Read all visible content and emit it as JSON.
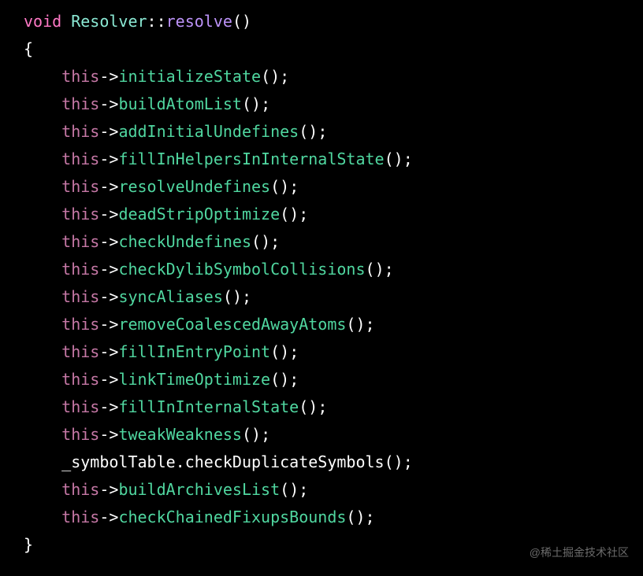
{
  "code": {
    "keyword_void": "void",
    "class_name": "Resolver",
    "scope_op": "::",
    "function_name": "resolve",
    "paren_open": "(",
    "paren_close": ")",
    "brace_open": "{",
    "brace_close": "}",
    "indent": "    ",
    "this_kw": "this",
    "arrow": "->",
    "semicolon": ";",
    "member_obj": "_symbolTable",
    "dot": ".",
    "member_call": "checkDuplicateSymbols",
    "methods": {
      "m0": "initializeState",
      "m1": "buildAtomList",
      "m2": "addInitialUndefines",
      "m3": "fillInHelpersInInternalState",
      "m4": "resolveUndefines",
      "m5": "deadStripOptimize",
      "m6": "checkUndefines",
      "m7": "checkDylibSymbolCollisions",
      "m8": "syncAliases",
      "m9": "removeCoalescedAwayAtoms",
      "m10": "fillInEntryPoint",
      "m11": "linkTimeOptimize",
      "m12": "fillInInternalState",
      "m13": "tweakWeakness",
      "m14": "buildArchivesList",
      "m15": "checkChainedFixupsBounds"
    }
  },
  "watermark": "@稀土掘金技术社区"
}
